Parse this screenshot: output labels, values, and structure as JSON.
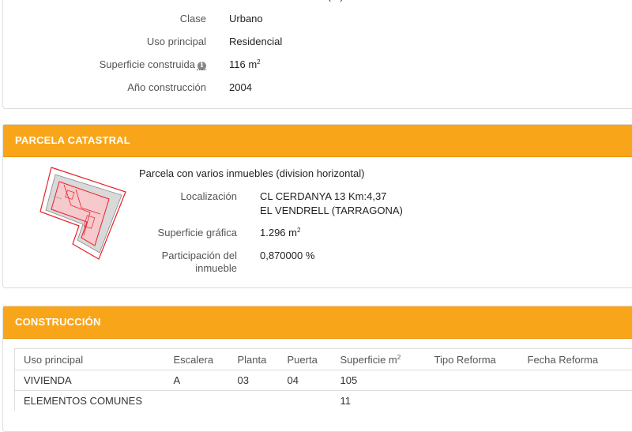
{
  "top": {
    "cut_text": "(...)",
    "rows": [
      {
        "label": "Clase",
        "value": "Urbano"
      },
      {
        "label": "Uso principal",
        "value": "Residencial"
      },
      {
        "label": "Superficie construida",
        "value": "116 m",
        "value_sup": "2",
        "info_icon": "info-circle-icon"
      },
      {
        "label": "Año construcción",
        "value": "2004"
      }
    ]
  },
  "parcela": {
    "heading": "PARCELA CATASTRAL",
    "description": "Parcela con varios inmuebles (division horizontal)",
    "localizacion_label": "Localización",
    "localizacion_line1": "CL CERDANYA 13 Km:4,37",
    "localizacion_line2": "EL VENDRELL (TARRAGONA)",
    "superficie_label": "Superficie gráfica",
    "superficie_value": "1.296 m",
    "superficie_sup": "2",
    "participacion_label_line1": "Participación del",
    "participacion_label_line2": "inmueble",
    "participacion_value": "0,870000 %",
    "map_icon": "parcel-map-thumbnail",
    "colors": {
      "accent": "#f9a51a",
      "parcel_outline": "#e8202a",
      "parcel_fill": "#f6c9cc"
    }
  },
  "construccion": {
    "heading": "CONSTRUCCIÓN",
    "columns": [
      "Uso principal",
      "Escalera",
      "Planta",
      "Puerta",
      "Superficie m",
      "Tipo Reforma",
      "Fecha Reforma"
    ],
    "superficie_sup": "2",
    "rows": [
      [
        "VIVIENDA",
        "A",
        "03",
        "04",
        "105",
        "",
        ""
      ],
      [
        "ELEMENTOS COMUNES",
        "",
        "",
        "",
        "11",
        "",
        ""
      ]
    ]
  }
}
